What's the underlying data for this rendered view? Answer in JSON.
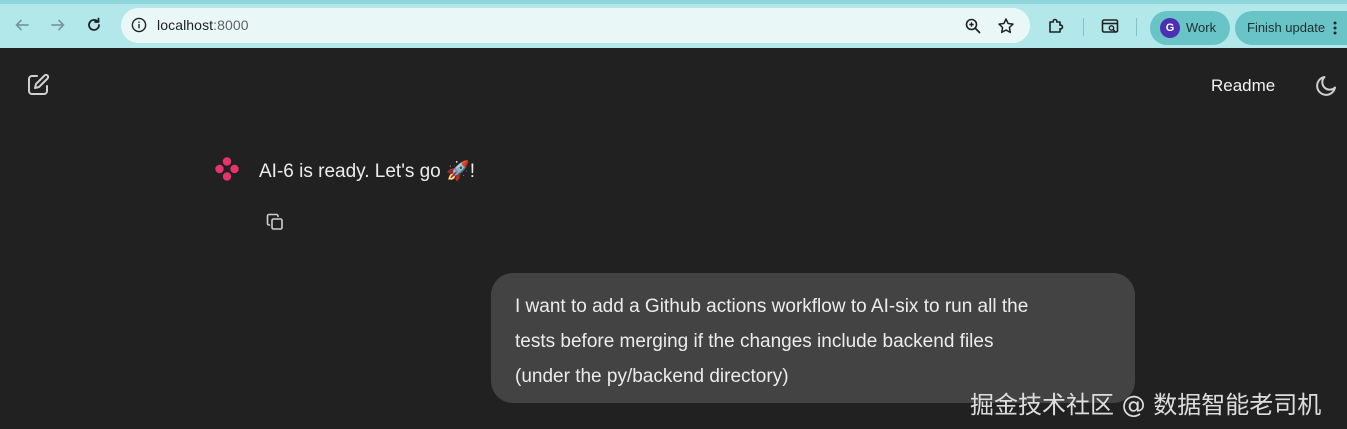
{
  "browser": {
    "url_host": "localhost",
    "url_port": ":8000",
    "profile_initial": "G",
    "profile_label": "Work",
    "update_label": "Finish update",
    "icons": [
      "back-icon",
      "forward-icon",
      "reload-icon",
      "site-info-icon",
      "zoom-icon",
      "bookmark-star-icon",
      "extensions-icon",
      "search-tabs-icon",
      "more-icon"
    ],
    "accent_color": "#b3e8ea",
    "avatar_color": "#4d2fb3"
  },
  "header": {
    "readme_label": "Readme"
  },
  "chat": {
    "bot_message": "AI-6 is ready. Let's go 🚀!",
    "user_message": "I want to add a Github actions workflow to AI-six to run all the\ntests before merging if the changes include backend files\n(under the py/backend directory)"
  },
  "watermark": {
    "text": "掘金技术社区 @ 数据智能老司机"
  },
  "colors": {
    "background": "#212121",
    "user_bubble": "#434343",
    "logo": "#e8336d"
  }
}
